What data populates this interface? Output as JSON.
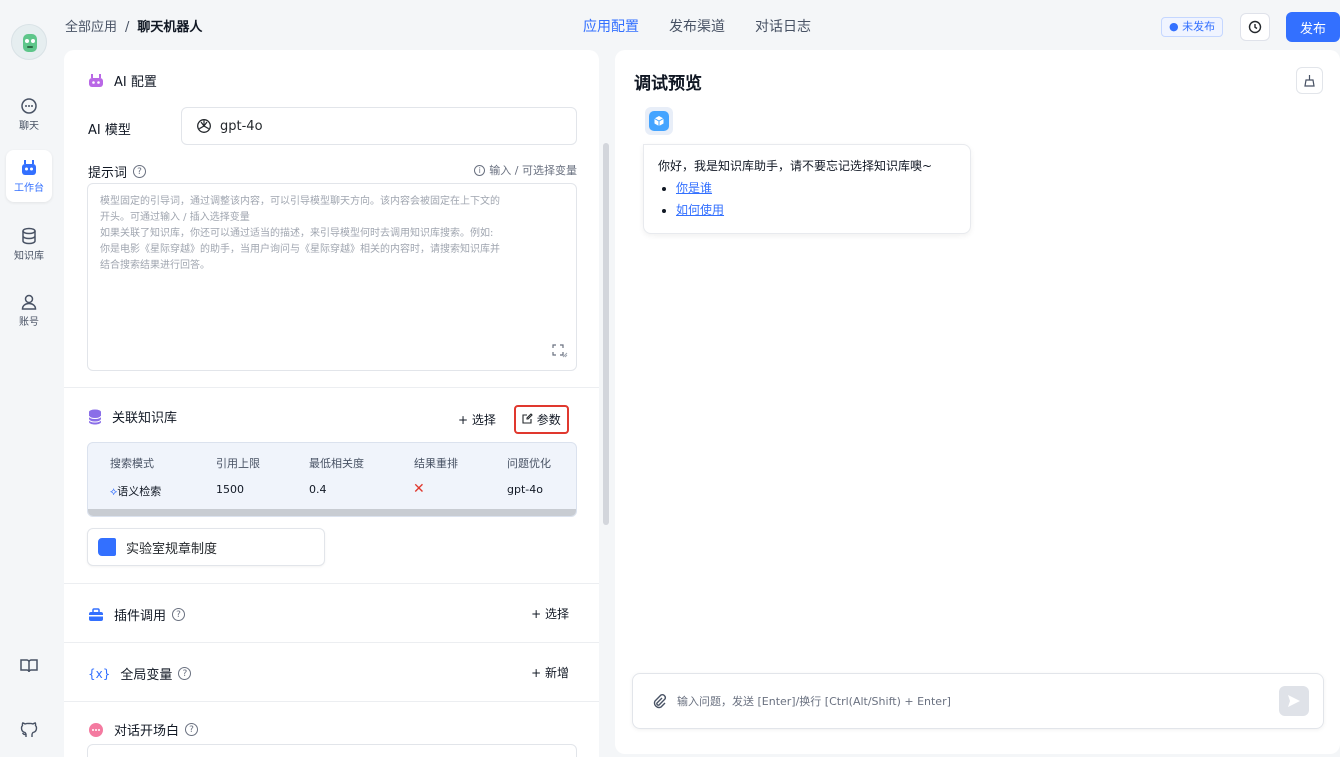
{
  "sidebar": {
    "items": [
      {
        "label": "聊天",
        "icon": "chat-icon"
      },
      {
        "label": "工作台",
        "icon": "robot-icon"
      },
      {
        "label": "知识库",
        "icon": "database-icon"
      },
      {
        "label": "账号",
        "icon": "user-icon"
      }
    ],
    "bottom_icons": [
      "book-icon",
      "github-icon"
    ]
  },
  "topbar": {
    "breadcrumb_root": "全部应用",
    "breadcrumb_sep": "/",
    "breadcrumb_current": "聊天机器人",
    "tabs": [
      "应用配置",
      "发布渠道",
      "对话日志"
    ],
    "status": "● 未发布",
    "publish_label": "发布"
  },
  "ai_config": {
    "title": "AI 配置",
    "model_label": "AI 模型",
    "model_value": "gpt-4o",
    "prompt_label": "提示词",
    "var_hint": "输入 / 可选择变量",
    "prompt_placeholder_lines": [
      "模型固定的引导词，通过调整该内容，可以引导模型聊天方向。该内容会被固定在上下文的",
      "开头。可通过输入 / 插入选择变量",
      "如果关联了知识库，你还可以通过适当的描述，来引导模型何时去调用知识库搜索。例如:",
      "你是电影《星际穿越》的助手，当用户询问与《星际穿越》相关的内容时，请搜索知识库并",
      "结合搜索结果进行回答。"
    ]
  },
  "knowledge": {
    "title": "关联知识库",
    "select_label": "+ 选择",
    "params_label": "参数",
    "headers": [
      "搜索模式",
      "引用上限",
      "最低相关度",
      "结果重排",
      "问题优化"
    ],
    "values": [
      "语义检索",
      "1500",
      "0.4",
      "✕",
      "gpt-4o"
    ],
    "dataset_name": "实验室规章制度"
  },
  "plugin": {
    "title": "插件调用",
    "action": "+ 选择"
  },
  "variables": {
    "title": "全局变量",
    "icon_text": "{x}",
    "action": "+ 新增"
  },
  "opening": {
    "title": "对话开场白"
  },
  "preview": {
    "title": "调试预览",
    "greeting": "你好，我是知识库助手，请不要忘记选择知识库噢~",
    "links": [
      "你是谁",
      "如何使用"
    ],
    "input_placeholder": "输入问题，发送 [Enter]/换行 [Ctrl(Alt/Shift) + Enter]"
  },
  "colors": {
    "accent": "#3370ff",
    "highlight_border": "#e0382e",
    "danger": "#e0382e"
  }
}
